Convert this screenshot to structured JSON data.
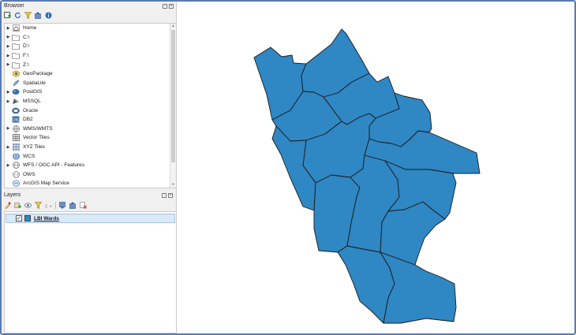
{
  "browser": {
    "title": "Browser",
    "items": [
      {
        "label": "Home",
        "icon": "home-icon",
        "expandable": true
      },
      {
        "label": "C:\\",
        "icon": "folder-icon",
        "expandable": true
      },
      {
        "label": "D:\\",
        "icon": "folder-icon",
        "expandable": true
      },
      {
        "label": "F:\\",
        "icon": "folder-icon",
        "expandable": true
      },
      {
        "label": "Z:\\",
        "icon": "folder-icon",
        "expandable": true
      },
      {
        "label": "GeoPackage",
        "icon": "geopackage-icon",
        "expandable": false
      },
      {
        "label": "SpatiaLite",
        "icon": "spatialite-icon",
        "expandable": false
      },
      {
        "label": "PostGIS",
        "icon": "postgis-icon",
        "expandable": true
      },
      {
        "label": "MSSQL",
        "icon": "mssql-icon",
        "expandable": true
      },
      {
        "label": "Oracle",
        "icon": "oracle-icon",
        "expandable": false
      },
      {
        "label": "DB2",
        "icon": "db2-icon",
        "expandable": false
      },
      {
        "label": "WMS/WMTS",
        "icon": "wms-icon",
        "expandable": true
      },
      {
        "label": "Vector Tiles",
        "icon": "vector-tiles-icon",
        "expandable": false
      },
      {
        "label": "XYZ Tiles",
        "icon": "xyz-tiles-icon",
        "expandable": true
      },
      {
        "label": "WCS",
        "icon": "wcs-icon",
        "expandable": false
      },
      {
        "label": "WFS / OGC API - Features",
        "icon": "wfs-icon",
        "expandable": true
      },
      {
        "label": "OWS",
        "icon": "ows-icon",
        "expandable": false
      },
      {
        "label": "ArcGIS Map Service",
        "icon": "arcgis-icon",
        "expandable": false
      }
    ]
  },
  "layers": {
    "title": "Layers",
    "items": [
      {
        "label": "LBI Wards",
        "checked": true,
        "color": "#2f87c4"
      }
    ]
  },
  "colors": {
    "polygon_fill": "#2f87c4",
    "polygon_stroke": "#1a1a1a",
    "accent": "#5a7ab0"
  }
}
